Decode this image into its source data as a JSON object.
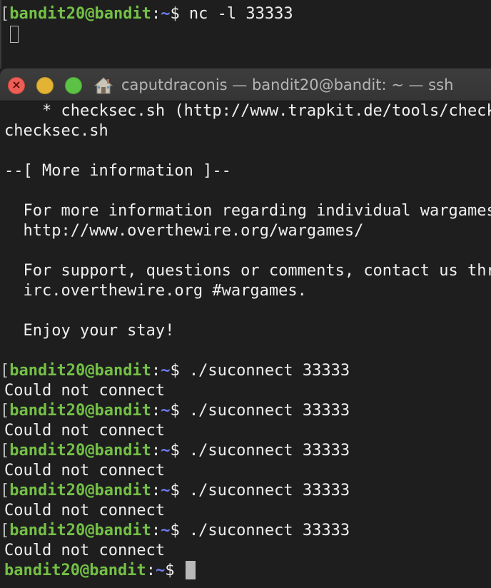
{
  "background_terminal": {
    "prompt_bracket": "[",
    "prompt_user": "bandit20@bandit",
    "prompt_colon": ":",
    "prompt_path": "~",
    "prompt_symbol": "$",
    "command": " nc -l 33333"
  },
  "window": {
    "title": "caputdraconis — bandit20@bandit: ~ — ssh",
    "icon": "home-icon"
  },
  "terminal": {
    "motd": [
      "    * checksec.sh (http://www.trapkit.de/tools/checksec.html) in /usr/local/bin/",
      "checksec.sh",
      "",
      "--[ More information ]--",
      "",
      "  For more information regarding individual wargames, visit",
      "  http://www.overthewire.org/wargames/",
      "",
      "  For support, questions or comments, contact us through IRC on",
      "  irc.overthewire.org #wargames.",
      "",
      "  Enjoy your stay!",
      ""
    ],
    "prompt": {
      "bracket": "[",
      "user": "bandit20@bandit",
      "colon": ":",
      "path": "~",
      "symbol": "$"
    },
    "sessions": [
      {
        "command": " ./suconnect 33333",
        "output": "Could not connect"
      },
      {
        "command": " ./suconnect 33333",
        "output": "Could not connect"
      },
      {
        "command": " ./suconnect 33333",
        "output": "Could not connect"
      },
      {
        "command": " ./suconnect 33333",
        "output": "Could not connect"
      },
      {
        "command": " ./suconnect 33333",
        "output": "Could not connect"
      }
    ],
    "final_command": " "
  },
  "colors": {
    "prompt_user": "#74c046",
    "prompt_path": "#6f7df3",
    "text": "#efefef",
    "background": "#1e1e1e"
  }
}
